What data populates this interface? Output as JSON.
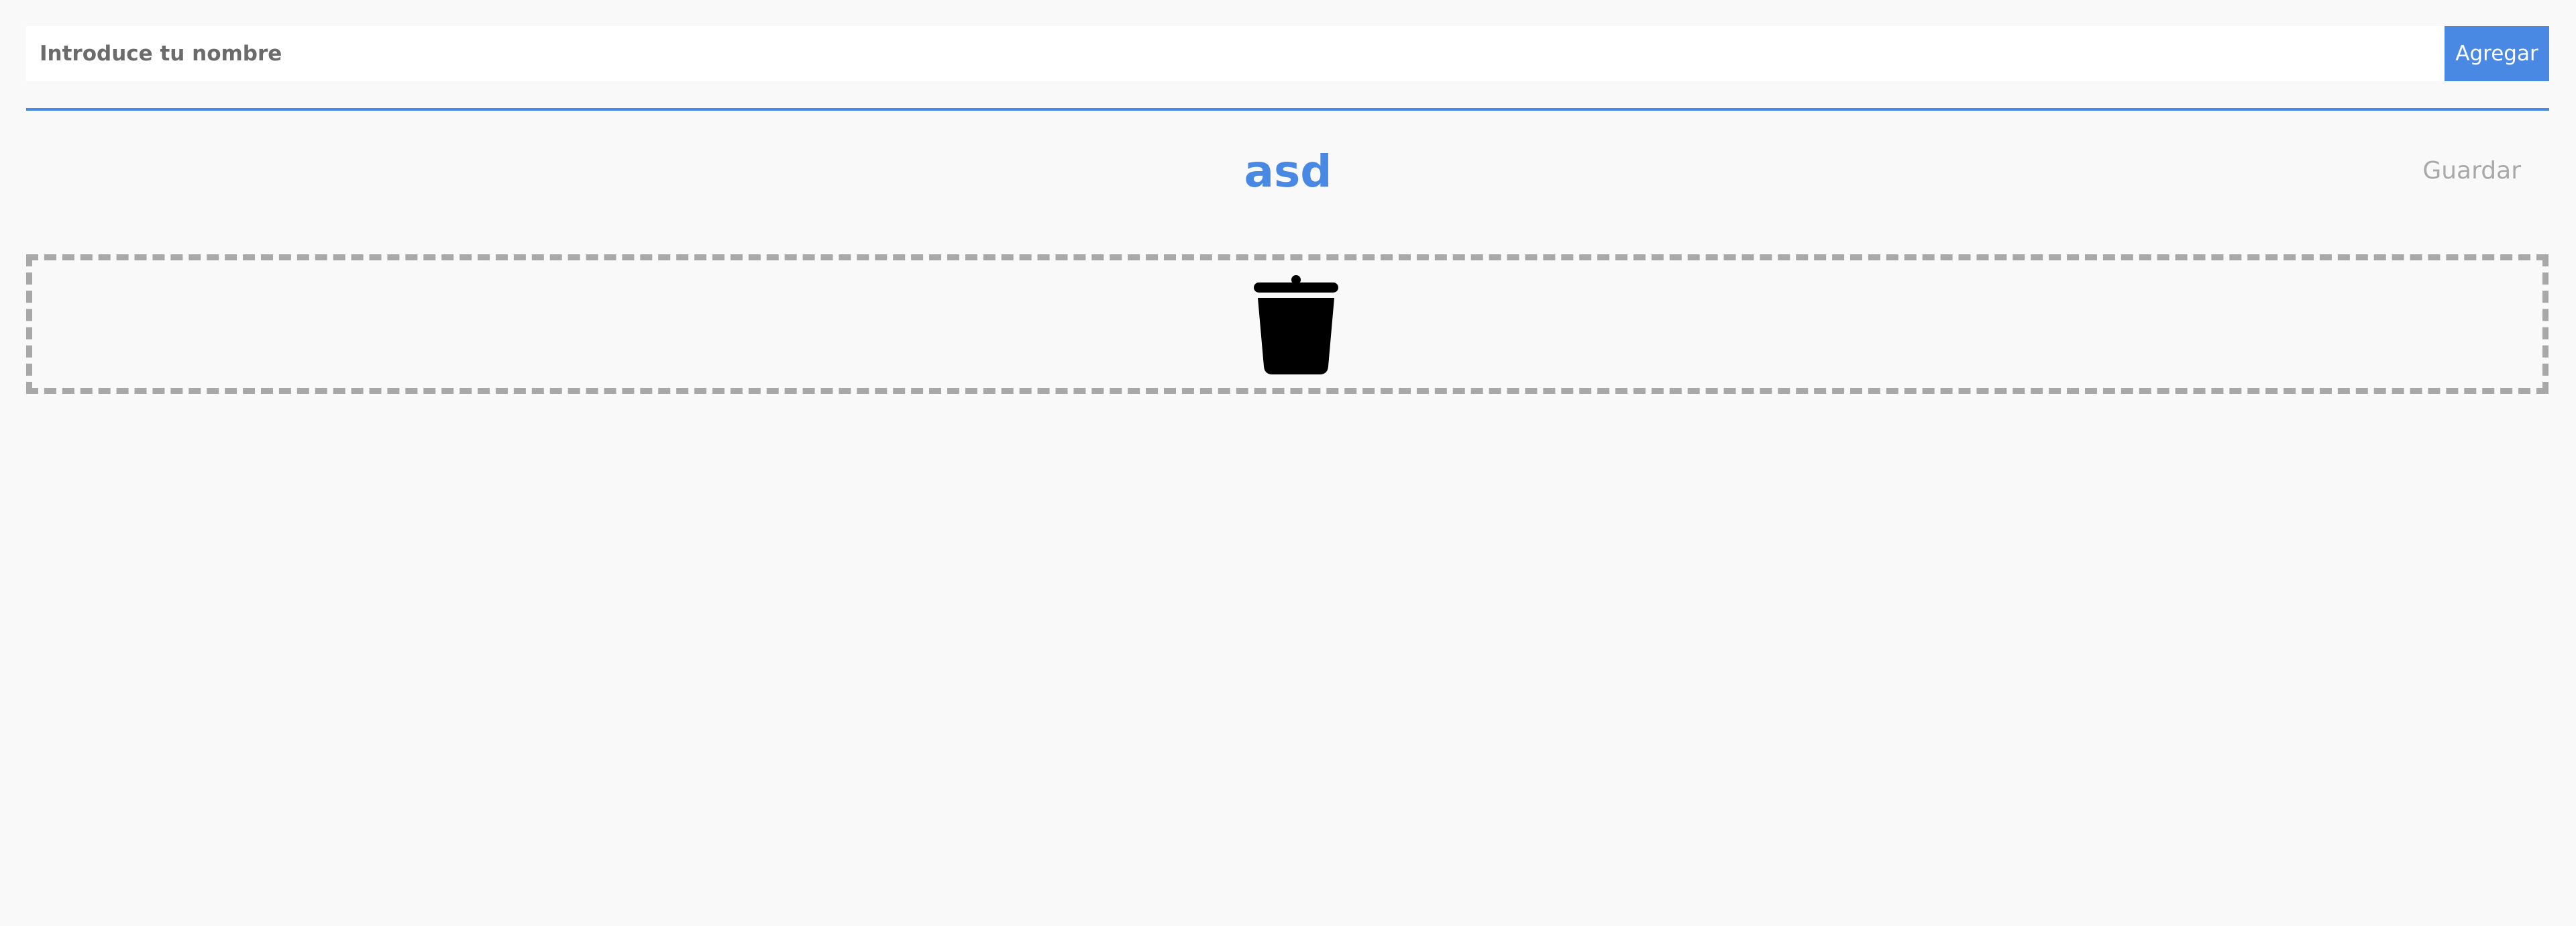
{
  "form": {
    "name_value": "",
    "name_placeholder": "Introduce tu nombre",
    "add_label": "Agregar"
  },
  "list": {
    "title": "asd",
    "save_label": "Guardar"
  },
  "trash": {
    "icon": "trash-icon"
  },
  "colors": {
    "accent": "#4a89e3",
    "background": "#f9f9f9",
    "muted": "#a9a9a9",
    "dashed_border": "#a8a8a8"
  }
}
